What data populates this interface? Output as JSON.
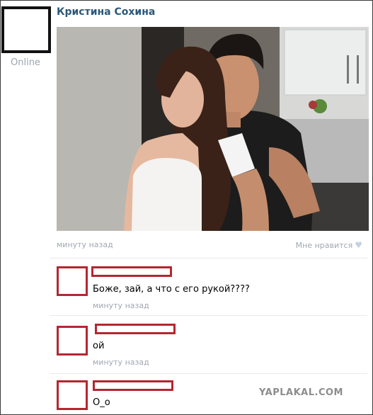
{
  "post": {
    "author": "Кристина Сохина",
    "status": "Online",
    "time": "минуту назад",
    "like_label": "Мне нравится",
    "like_icon": "heart-icon"
  },
  "comments": [
    {
      "text": "Боже, зай, а что с его рукой????",
      "time": "минуту назад"
    },
    {
      "text": "ой",
      "time": "минуту назад"
    },
    {
      "text": "О_о"
    }
  ],
  "watermark": "YAPLAKAL.COM",
  "colors": {
    "author_link": "#2b587a",
    "meta_gray": "#a0a8b2",
    "redaction_red": "#b52631"
  }
}
